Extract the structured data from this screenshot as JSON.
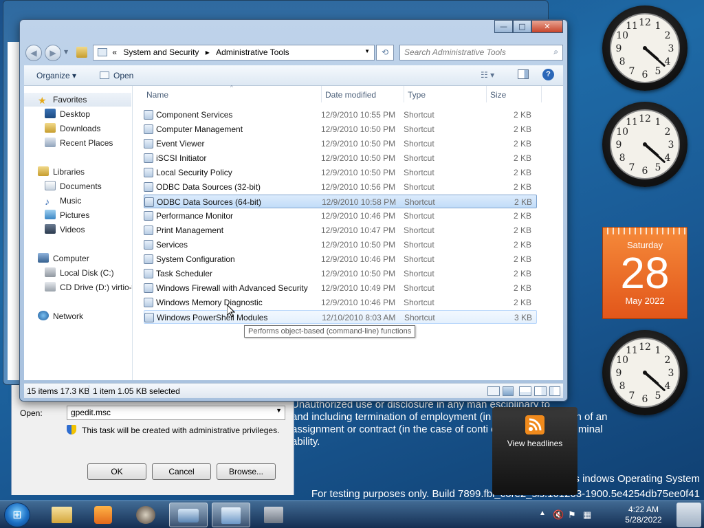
{
  "desktop": {
    "legal_lines": [
      "Unauthorized use or disclosure in any man              esciplinary         to",
      "and including termination of employment (in         oyees), termination of an",
      "assignment or contract (in the case of conti        otential civil and criminal",
      "ability."
    ],
    "watermark_line1": "Micros                    indows Operating System",
    "watermark_line2": "For testing purposes only. Build 7899.fbl_core2_sis.101203-1900.5e4254db75ee0f41"
  },
  "gadgets": {
    "clocks": [
      {
        "hour": 4,
        "minute": 22
      },
      {
        "hour": 4,
        "minute": 22
      },
      {
        "hour": 4,
        "minute": 22
      }
    ],
    "calendar": {
      "day_of_week": "Saturday",
      "day": "28",
      "month_year": "May 2022"
    },
    "headlines": {
      "label": "View headlines",
      "icon": "rss-icon"
    }
  },
  "run_dialog": {
    "open_label": "Open:",
    "open_value": "gpedit.msc",
    "admin_note": "This task will be created with administrative privileges.",
    "ok": "OK",
    "cancel": "Cancel",
    "browse": "Browse..."
  },
  "explorer": {
    "controls": {
      "minimize": "—",
      "maximize": "□",
      "close": "✕"
    },
    "breadcrumb": [
      "«",
      "System and Security",
      "Administrative Tools"
    ],
    "search_placeholder": "Search Administrative Tools",
    "toolbar": {
      "organize": "Organize ▾",
      "open": "Open"
    },
    "nav": {
      "favorites": "Favorites",
      "desktop": "Desktop",
      "downloads": "Downloads",
      "recent": "Recent Places",
      "libraries": "Libraries",
      "documents": "Documents",
      "music": "Music",
      "pictures": "Pictures",
      "videos": "Videos",
      "computer": "Computer",
      "local_disk": "Local Disk (C:)",
      "cd_drive": "CD Drive (D:) virtio-w",
      "network": "Network"
    },
    "columns": {
      "name": "Name",
      "date": "Date modified",
      "type": "Type",
      "size": "Size"
    },
    "files": [
      {
        "name": "Component Services",
        "date": "12/9/2010 10:55 PM",
        "type": "Shortcut",
        "size": "2 KB"
      },
      {
        "name": "Computer Management",
        "date": "12/9/2010 10:50 PM",
        "type": "Shortcut",
        "size": "2 KB"
      },
      {
        "name": "Event Viewer",
        "date": "12/9/2010 10:50 PM",
        "type": "Shortcut",
        "size": "2 KB"
      },
      {
        "name": "iSCSI Initiator",
        "date": "12/9/2010 10:50 PM",
        "type": "Shortcut",
        "size": "2 KB"
      },
      {
        "name": "Local Security Policy",
        "date": "12/9/2010 10:50 PM",
        "type": "Shortcut",
        "size": "2 KB"
      },
      {
        "name": "ODBC Data Sources (32-bit)",
        "date": "12/9/2010 10:56 PM",
        "type": "Shortcut",
        "size": "2 KB"
      },
      {
        "name": "ODBC Data Sources (64-bit)",
        "date": "12/9/2010 10:58 PM",
        "type": "Shortcut",
        "size": "2 KB"
      },
      {
        "name": "Performance Monitor",
        "date": "12/9/2010 10:46 PM",
        "type": "Shortcut",
        "size": "2 KB"
      },
      {
        "name": "Print Management",
        "date": "12/9/2010 10:47 PM",
        "type": "Shortcut",
        "size": "2 KB"
      },
      {
        "name": "Services",
        "date": "12/9/2010 10:50 PM",
        "type": "Shortcut",
        "size": "2 KB"
      },
      {
        "name": "System Configuration",
        "date": "12/9/2010 10:46 PM",
        "type": "Shortcut",
        "size": "2 KB"
      },
      {
        "name": "Task Scheduler",
        "date": "12/9/2010 10:50 PM",
        "type": "Shortcut",
        "size": "2 KB"
      },
      {
        "name": "Windows Firewall with Advanced Security",
        "date": "12/9/2010 10:49 PM",
        "type": "Shortcut",
        "size": "2 KB"
      },
      {
        "name": "Windows Memory Diagnostic",
        "date": "12/9/2010 10:46 PM",
        "type": "Shortcut",
        "size": "2 KB"
      },
      {
        "name": "Windows PowerShell Modules",
        "date": "12/10/2010 8:03 AM",
        "type": "Shortcut",
        "size": "3 KB"
      }
    ],
    "selected_index": 6,
    "hover_index": 14,
    "tooltip": "Performs object-based (command-line) functions",
    "status": {
      "items": "15 items 17.3 KB",
      "selected": "1 item 1.05 KB selected"
    }
  },
  "taskbar": {
    "time": "4:22 AM",
    "date": "5/28/2022"
  }
}
